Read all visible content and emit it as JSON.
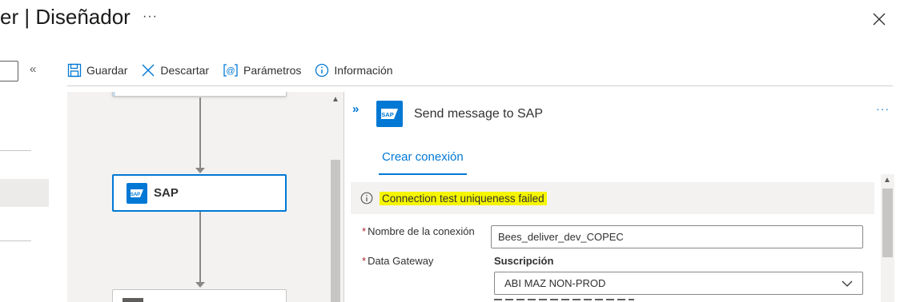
{
  "header": {
    "title": "er | Diseñador",
    "more": "···"
  },
  "toolbar": {
    "save_label": "Guardar",
    "discard_label": "Descartar",
    "params_label": "Parámetros",
    "info_label": "Información"
  },
  "left_nav": {
    "collapse": "«"
  },
  "canvas": {
    "sap_card_label": "SAP",
    "sap_logo_text": "SAP"
  },
  "panel": {
    "expand": "»",
    "title": "Send message to SAP",
    "more": "···",
    "tab_label": "Crear conexión",
    "alert_text": "Connection test uniqueness failed",
    "connection_name_label": "Nombre de la conexión",
    "connection_name_value": "Bees_deliver_dev_COPEC",
    "gateway_label": "Data Gateway",
    "subscription_label": "Suscripción",
    "subscription_value": "ABI MAZ NON-PROD",
    "required_mark": "*"
  },
  "colors": {
    "accent": "#0078d4",
    "highlight": "#f5f500",
    "required": "#a4262c"
  }
}
